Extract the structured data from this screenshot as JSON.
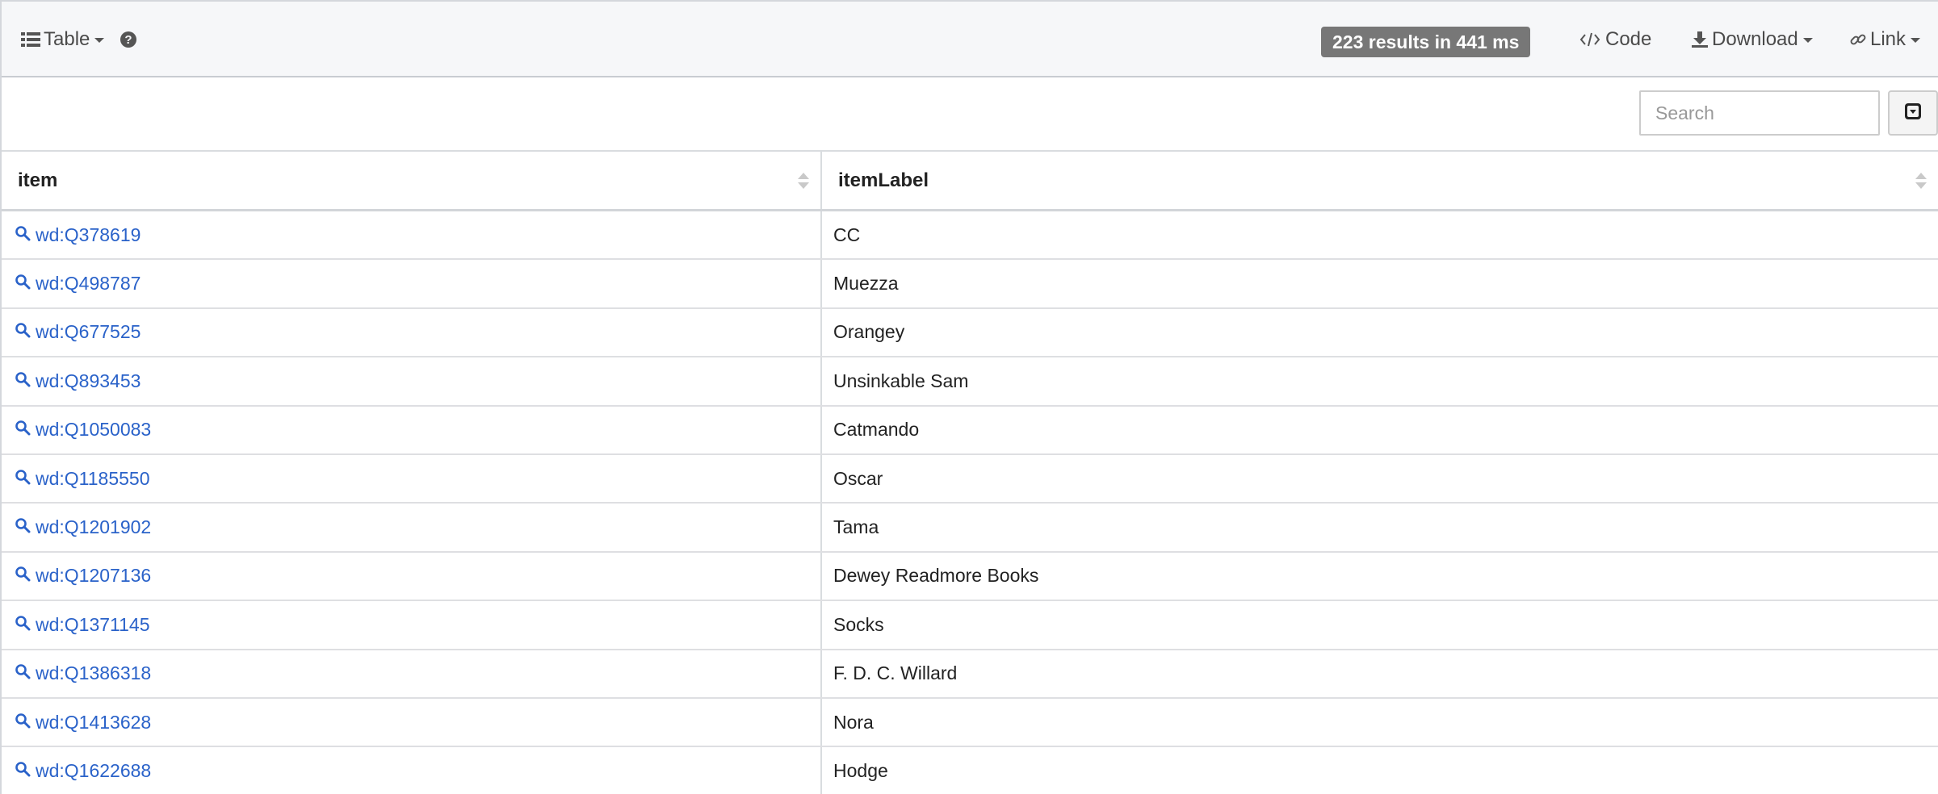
{
  "toolbar": {
    "view_label": "Table",
    "results_badge": "223 results in 441 ms",
    "code_label": "Code",
    "download_label": "Download",
    "link_label": "Link"
  },
  "search": {
    "placeholder": "Search"
  },
  "table": {
    "columns": [
      "item",
      "itemLabel"
    ],
    "rows": [
      {
        "item": "wd:Q378619",
        "label": "CC"
      },
      {
        "item": "wd:Q498787",
        "label": "Muezza"
      },
      {
        "item": "wd:Q677525",
        "label": "Orangey"
      },
      {
        "item": "wd:Q893453",
        "label": "Unsinkable Sam"
      },
      {
        "item": "wd:Q1050083",
        "label": "Catmando"
      },
      {
        "item": "wd:Q1185550",
        "label": "Oscar"
      },
      {
        "item": "wd:Q1201902",
        "label": "Tama"
      },
      {
        "item": "wd:Q1207136",
        "label": "Dewey Readmore Books"
      },
      {
        "item": "wd:Q1371145",
        "label": "Socks"
      },
      {
        "item": "wd:Q1386318",
        "label": "F. D. C. Willard"
      },
      {
        "item": "wd:Q1413628",
        "label": "Nora"
      },
      {
        "item": "wd:Q1622688",
        "label": "Hodge"
      }
    ]
  },
  "colors": {
    "link": "#2a62c9",
    "badge_bg": "#777777",
    "toolbar_bg": "#f6f7f9"
  },
  "icons": {
    "view": "table-list-icon",
    "help": "question-circle-icon",
    "code": "code-icon",
    "download": "download-icon",
    "link": "link-icon",
    "toggle": "caret-square-down-icon",
    "row": "search-icon"
  }
}
